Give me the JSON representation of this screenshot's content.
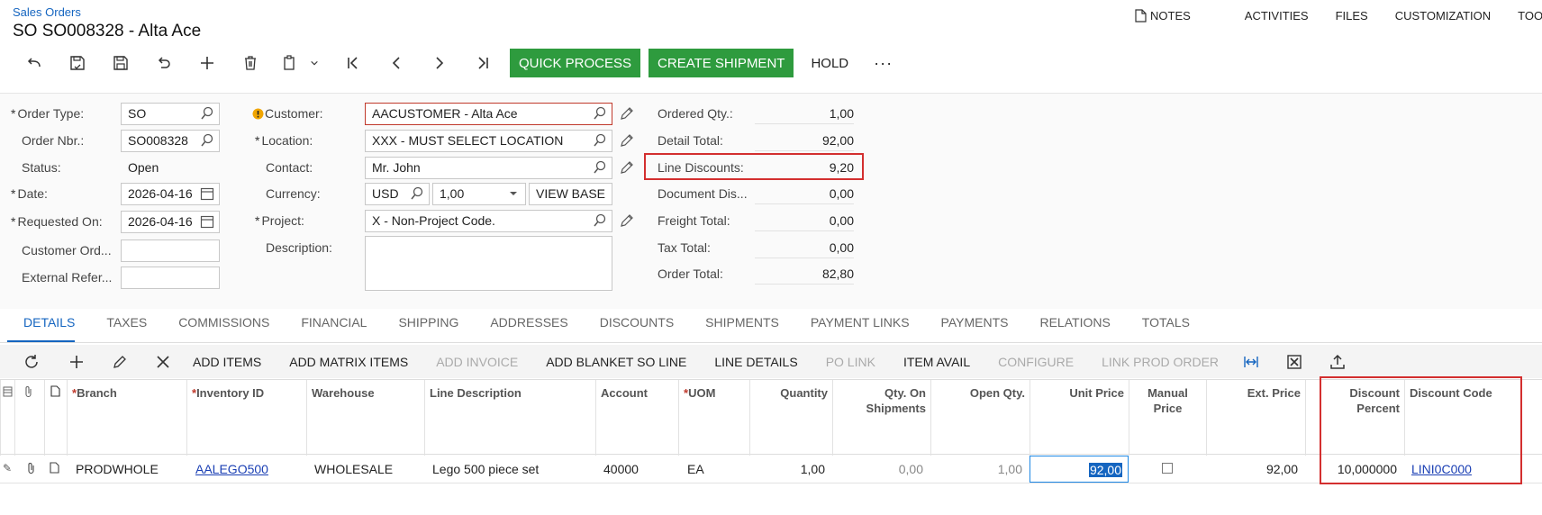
{
  "header": {
    "breadcrumb": "Sales Orders",
    "title": "SO SO008328 - Alta Ace",
    "nav": [
      "NOTES",
      "ACTIVITIES",
      "FILES",
      "CUSTOMIZATION",
      "TOOLS"
    ]
  },
  "toolbar": {
    "quick_process": "QUICK PROCESS",
    "create_shipment": "CREATE SHIPMENT",
    "hold": "HOLD",
    "more": "···"
  },
  "form": {
    "order_type_label": "Order Type:",
    "order_type": "SO",
    "order_nbr_label": "Order Nbr.:",
    "order_nbr": "SO008328",
    "status_label": "Status:",
    "status": "Open",
    "date_label": "Date:",
    "date": "2026-04-16",
    "requested_on_label": "Requested On:",
    "requested_on": "2026-04-16",
    "customer_ord_label": "Customer Ord...",
    "customer_ord": "",
    "external_ref_label": "External Refer...",
    "external_ref": "",
    "customer_label": "Customer:",
    "customer": "AACUSTOMER - Alta Ace",
    "location_label": "Location:",
    "location": "XXX - MUST SELECT LOCATION",
    "contact_label": "Contact:",
    "contact": "Mr. John",
    "currency_label": "Currency:",
    "currency": "USD",
    "rate": "1,00",
    "view_base": "VIEW BASE",
    "project_label": "Project:",
    "project": "X - Non-Project Code.",
    "description_label": "Description:",
    "description": ""
  },
  "summary": {
    "ordered_qty_label": "Ordered Qty.:",
    "ordered_qty": "1,00",
    "detail_total_label": "Detail Total:",
    "detail_total": "92,00",
    "line_discounts_label": "Line Discounts:",
    "line_discounts": "9,20",
    "document_dis_label": "Document Dis...",
    "document_dis": "0,00",
    "freight_total_label": "Freight Total:",
    "freight_total": "0,00",
    "tax_total_label": "Tax Total:",
    "tax_total": "0,00",
    "order_total_label": "Order Total:",
    "order_total": "82,80"
  },
  "tabs": [
    "DETAILS",
    "TAXES",
    "COMMISSIONS",
    "FINANCIAL",
    "SHIPPING",
    "ADDRESSES",
    "DISCOUNTS",
    "SHIPMENTS",
    "PAYMENT LINKS",
    "PAYMENTS",
    "RELATIONS",
    "TOTALS"
  ],
  "grid_toolbar": {
    "add_items": "ADD ITEMS",
    "add_matrix_items": "ADD MATRIX ITEMS",
    "add_invoice": "ADD INVOICE",
    "add_blanket_so_line": "ADD BLANKET SO LINE",
    "line_details": "LINE DETAILS",
    "po_link": "PO LINK",
    "item_avail": "ITEM AVAIL",
    "configure": "CONFIGURE",
    "link_prod_order": "LINK PROD ORDER"
  },
  "grid": {
    "columns": {
      "branch": "Branch",
      "inventory_id": "Inventory ID",
      "warehouse": "Warehouse",
      "line_description": "Line Description",
      "account": "Account",
      "uom": "UOM",
      "quantity": "Quantity",
      "qty_on_shipments_1": "Qty. On",
      "qty_on_shipments_2": "Shipments",
      "open_qty": "Open Qty.",
      "unit_price": "Unit Price",
      "manual_price_1": "Manual",
      "manual_price_2": "Price",
      "ext_price": "Ext. Price",
      "discount_percent_1": "Discount",
      "discount_percent_2": "Percent",
      "discount_code": "Discount Code"
    },
    "rows": [
      {
        "branch": "PRODWHOLE",
        "inventory_id": "AALEGO500",
        "warehouse": "WHOLESALE",
        "line_description": "Lego 500 piece set",
        "account": "40000",
        "uom": "EA",
        "quantity": "1,00",
        "qty_on_shipments": "0,00",
        "open_qty": "1,00",
        "unit_price": "92,00",
        "ext_price": "92,00",
        "discount_percent": "10,000000",
        "discount_code": "LINI0C000"
      }
    ]
  }
}
